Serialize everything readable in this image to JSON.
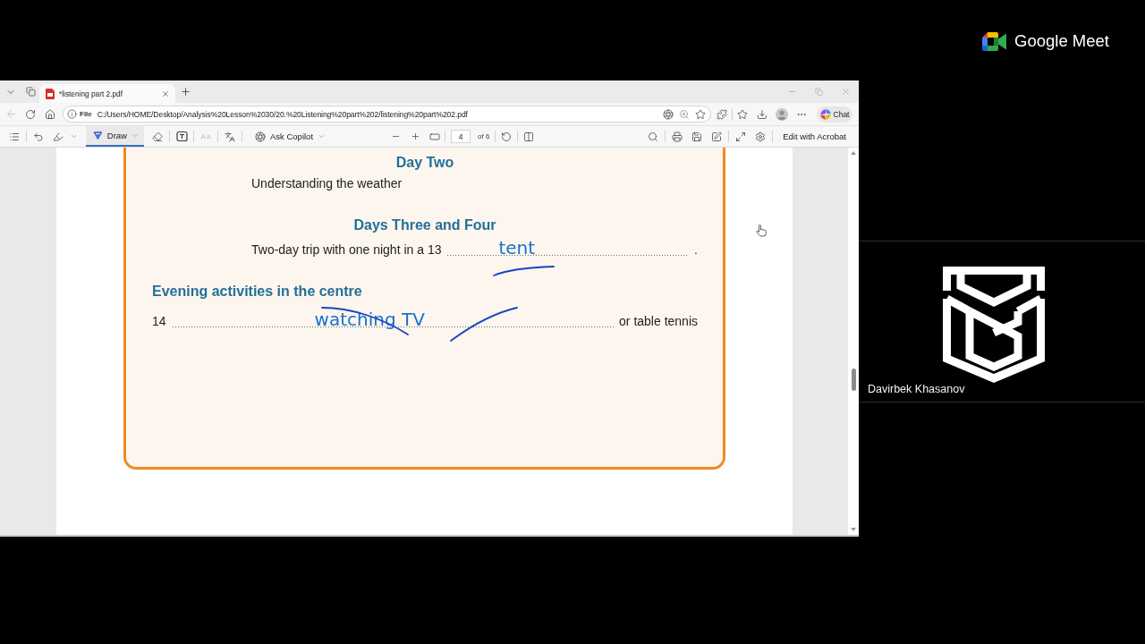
{
  "browser": {
    "tabs": [
      {
        "title": "*listening part 2.pdf",
        "selected": true
      }
    ],
    "back_button": {
      "disabled": true
    },
    "address_bar": {
      "scheme": "File",
      "url": "C:/Users/HOME/Desktop/Analysis%20Lesson%2030/20.%20Listening%20part%202/listening%20part%202.pdf"
    },
    "chat_button": "Chat"
  },
  "pdf_toolbar": {
    "draw_button": {
      "label": "Draw",
      "selected": true
    },
    "text_style_button": {
      "disabled": true
    },
    "ask_copilot": "Ask Copilot",
    "page_number": "4",
    "page_count": "of 6",
    "edit_button": "Edit with Acrobat"
  },
  "document": {
    "sections": [
      {
        "kind": "day",
        "title": "Day Two",
        "items": [
          {
            "kind": "text",
            "text": "Understanding the weather"
          }
        ]
      },
      {
        "kind": "day",
        "title": "Days Three and Four",
        "items": [
          {
            "kind": "gap",
            "before": "Two-day trip with one night in a 13",
            "answer": "tent",
            "after": ".",
            "ink": [
              {
                "kind": "underline"
              }
            ]
          }
        ]
      },
      {
        "kind": "topic",
        "title": "Evening activities in the centre",
        "items": [
          {
            "kind": "gap",
            "before": "14",
            "answer": "watching TV",
            "after": "or table tennis",
            "ink": [
              {
                "kind": "strike"
              },
              {
                "kind": "tick"
              }
            ]
          }
        ]
      }
    ]
  },
  "meet": {
    "brand": "Google Meet",
    "participant": {
      "name": "Davirbek Khasanov"
    }
  }
}
